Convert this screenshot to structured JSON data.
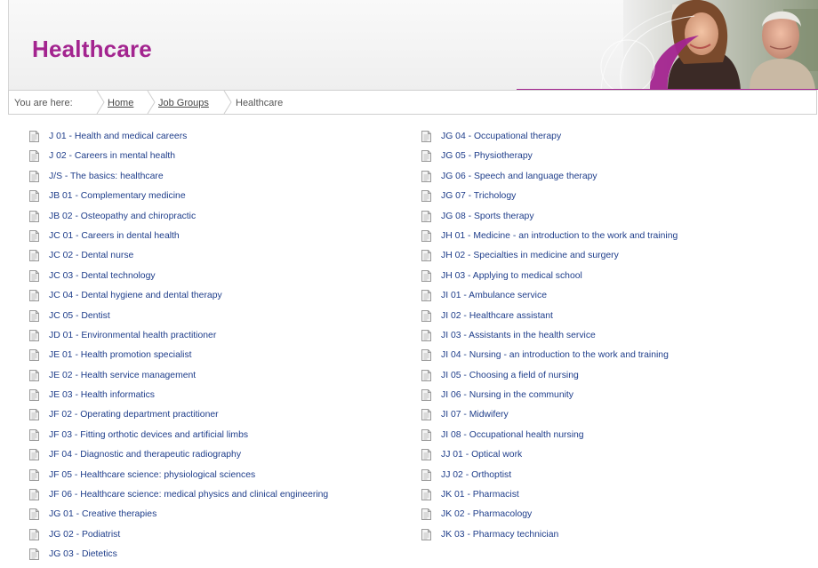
{
  "page": {
    "title": "Healthcare"
  },
  "breadcrumb": {
    "lead": "You are here:",
    "items": [
      {
        "label": "Home"
      },
      {
        "label": "Job Groups"
      },
      {
        "label": "Healthcare"
      }
    ]
  },
  "colors": {
    "brand": "#a3248f",
    "link": "#1e3d8a"
  },
  "icons": {
    "list_item": "document-icon"
  },
  "list_left": [
    "J 01 - Health and medical careers",
    "J 02 - Careers in mental health",
    "J/S - The basics: healthcare",
    "JB 01 - Complementary medicine",
    "JB 02 - Osteopathy and chiropractic",
    "JC 01 - Careers in dental health",
    "JC 02 - Dental nurse",
    "JC 03 - Dental technology",
    "JC 04 - Dental hygiene and dental therapy",
    "JC 05 - Dentist",
    "JD 01 - Environmental health practitioner",
    "JE 01 - Health promotion specialist",
    "JE 02 - Health service management",
    "JE 03 - Health informatics",
    "JF 02 - Operating department practitioner",
    "JF 03 - Fitting orthotic devices and artificial limbs",
    "JF 04 - Diagnostic and therapeutic radiography",
    "JF 05 - Healthcare science: physiological sciences",
    "JF 06 - Healthcare science: medical physics and clinical engineering",
    "JG 01 - Creative therapies",
    "JG 02 - Podiatrist",
    "JG 03 - Dietetics"
  ],
  "list_right": [
    "JG 04 - Occupational therapy",
    "JG 05 - Physiotherapy",
    "JG 06 - Speech and language therapy",
    "JG 07 - Trichology",
    "JG 08 - Sports therapy",
    "JH 01 - Medicine - an introduction to the work and training",
    "JH 02 - Specialties in medicine and surgery",
    "JH 03 - Applying to medical school",
    "JI 01 - Ambulance service",
    "JI 02 - Healthcare assistant",
    "JI 03 - Assistants in the health service",
    "JI 04 - Nursing - an introduction to the work and training",
    "JI 05 - Choosing a field of nursing",
    "JI 06 - Nursing in the community",
    "JI 07 - Midwifery",
    "JI 08 - Occupational health nursing",
    "JJ 01 - Optical work",
    "JJ 02 - Orthoptist",
    "JK 01 - Pharmacist",
    "JK 02 - Pharmacology",
    "JK 03 - Pharmacy technician"
  ]
}
